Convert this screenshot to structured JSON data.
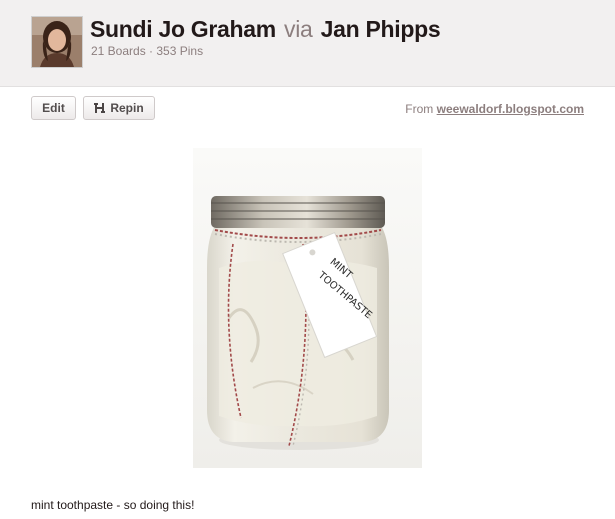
{
  "pinner": {
    "name": "Sundi Jo Graham",
    "via": "via",
    "via_name": "Jan Phipps",
    "stats": "21 Boards · 353 Pins"
  },
  "actions": {
    "edit_label": "Edit",
    "repin_label": "Repin"
  },
  "source": {
    "prefix": "From",
    "domain": "weewaldorf.blogspot.com"
  },
  "pin": {
    "tag_line1": "MINT",
    "tag_line2": "TOOTHPASTE",
    "description": "mint toothpaste - so doing this!"
  },
  "icons": {
    "repin": "repin-icon"
  }
}
